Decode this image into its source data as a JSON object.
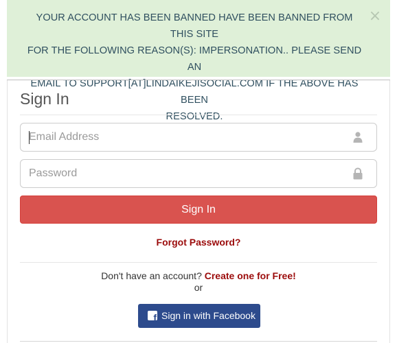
{
  "alert": {
    "line1": "YOUR ACCOUNT HAS BEEN BANNED HAVE BEEN BANNED FROM THIS SITE",
    "line2": "FOR THE FOLLOWING REASON(S): IMPERSONATION.. PLEASE SEND AN",
    "line3": "EMAIL TO SUPPORT[AT]LINDAIKEJISOCIAL.COM IF THE ABOVE HAS BEEN",
    "line4": "RESOLVED.",
    "close_symbol": "×",
    "close_icon": "close-icon",
    "background_color": "#dff0d8"
  },
  "signin_form": {
    "title": "Sign In",
    "email": {
      "placeholder": "Email Address",
      "value": "",
      "icon": "user-icon"
    },
    "password": {
      "placeholder": "Password",
      "value": "",
      "icon": "lock-icon"
    },
    "submit_label": "Sign In",
    "submit_color": "#d9534f",
    "forgot_password_label": "Forgot Password?",
    "signup_prompt": "Don't have an account?",
    "signup_link_label": "Create one for Free!",
    "or_label": "or",
    "facebook": {
      "label": "Sign in with Facebook",
      "icon": "facebook-icon",
      "icon_glyph": "f",
      "color": "#2d4b8d"
    },
    "link_color": "#9b0b0b"
  }
}
